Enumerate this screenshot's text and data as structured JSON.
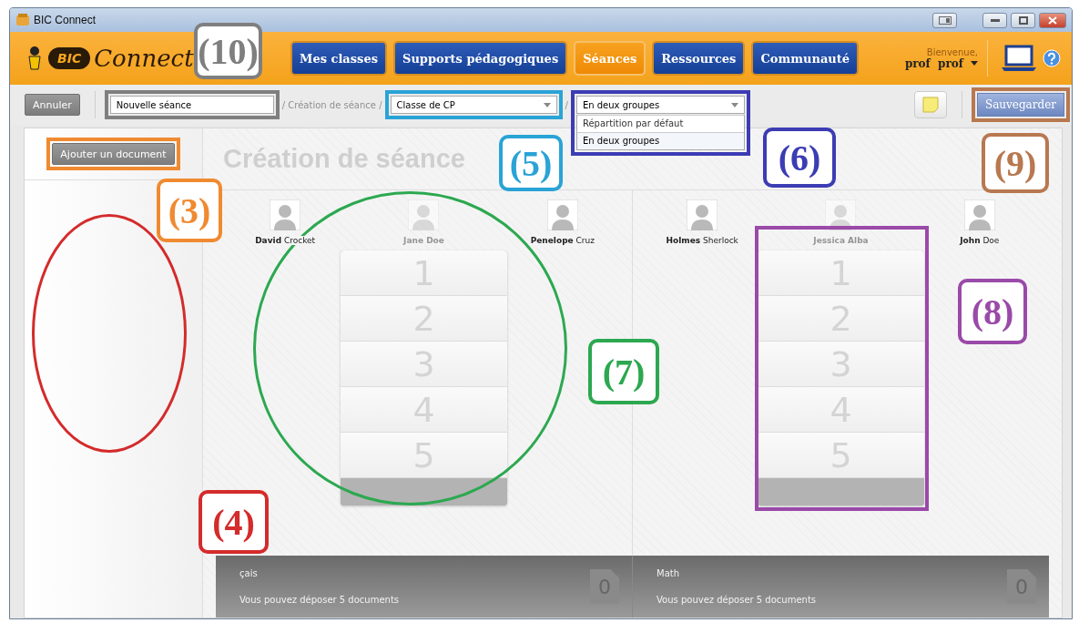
{
  "window": {
    "title": "BIC Connect"
  },
  "header": {
    "logo_brand": "BIC",
    "logo_text": "Connect",
    "nav": [
      {
        "label": "Mes classes",
        "selected": false
      },
      {
        "label": "Supports pédagogiques",
        "selected": false
      },
      {
        "label": "Séances",
        "selected": true
      },
      {
        "label": "Ressources",
        "selected": false
      },
      {
        "label": "Communauté",
        "selected": false
      }
    ],
    "welcome": "Bienvenue,",
    "user": "prof  prof"
  },
  "toolbar": {
    "cancel": "Annuler",
    "session_name": "Nouvelle séance",
    "crumb": "/ Création de séance /",
    "class_select": "Classe de CP",
    "sep": "/",
    "split_select": "En deux groupes",
    "split_options": [
      {
        "label": "Répartition par défaut",
        "selected": false
      },
      {
        "label": "En deux groupes",
        "selected": true
      }
    ],
    "save": "Sauvegarder"
  },
  "sidebar": {
    "add_document": "Ajouter un document"
  },
  "title": "Création de séance",
  "groups": [
    {
      "students": [
        {
          "name": "**David** Crocket",
          "dimmed": false
        },
        {
          "name": "Jane Doe",
          "dimmed": true
        },
        {
          "name": "**Penelope** Cruz",
          "dimmed": false
        }
      ],
      "slots": [
        "1",
        "2",
        "3",
        "4",
        "5"
      ],
      "subject": "çais",
      "note": "Vous pouvez déposer 5 documents",
      "count": "0"
    },
    {
      "students": [
        {
          "name": "**Holmes** Sherlock",
          "dimmed": false
        },
        {
          "name": "Jessica Alba",
          "dimmed": true
        },
        {
          "name": "**John** Doe",
          "dimmed": false
        }
      ],
      "slots": [
        "1",
        "2",
        "3",
        "4",
        "5"
      ],
      "subject": "Math",
      "note": "Vous pouvez déposer 5 documents",
      "count": "0"
    }
  ],
  "annotations": [
    {
      "kind": "label",
      "label": "(10)",
      "color": "#7f7f7f"
    },
    {
      "kind": "rect",
      "color": "#7f7f7f"
    },
    {
      "kind": "label",
      "label": "(3)",
      "color": "#f08a30"
    },
    {
      "kind": "rect",
      "color": "#f08a30"
    },
    {
      "kind": "ellipse",
      "color": "#d42b2b"
    },
    {
      "kind": "label",
      "label": "(4)",
      "color": "#d42b2b"
    },
    {
      "kind": "label",
      "label": "(5)",
      "color": "#2aa3d6"
    },
    {
      "kind": "rect",
      "color": "#2aa3d6"
    },
    {
      "kind": "label",
      "label": "(6)",
      "color": "#3c3cb4"
    },
    {
      "kind": "rect",
      "color": "#3c3cb4"
    },
    {
      "kind": "label",
      "label": "(7)",
      "color": "#2ca850"
    },
    {
      "kind": "ellipse",
      "color": "#2ca850"
    },
    {
      "kind": "label",
      "label": "(8)",
      "color": "#9a4aa8"
    },
    {
      "kind": "rect",
      "color": "#9a4aa8"
    },
    {
      "kind": "label",
      "label": "(9)",
      "color": "#b87850"
    },
    {
      "kind": "rect",
      "color": "#b87850"
    }
  ]
}
